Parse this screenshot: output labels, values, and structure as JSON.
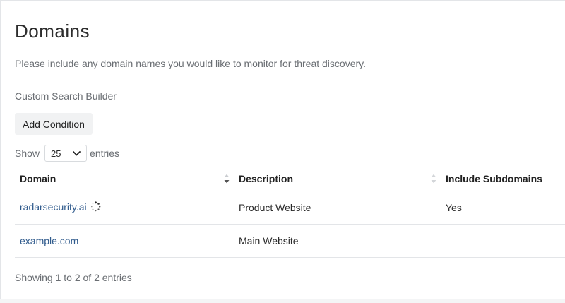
{
  "page": {
    "title": "Domains",
    "intro": "Please include any domain names you would like to monitor for threat discovery.",
    "builder_label": "Custom Search Builder",
    "add_condition_label": "Add Condition"
  },
  "length": {
    "prefix": "Show",
    "value": "25",
    "suffix": "entries"
  },
  "table": {
    "columns": [
      "Domain",
      "Description",
      "Include Subdomains"
    ],
    "rows": [
      {
        "domain": "radarsecurity.ai",
        "description": "Product Website",
        "include_subdomains": "Yes",
        "loading": true
      },
      {
        "domain": "example.com",
        "description": "Main Website",
        "include_subdomains": "",
        "loading": false
      }
    ]
  },
  "info": "Showing 1 to 2 of 2 entries",
  "icons": {
    "sort_active": "sort-desc-icon",
    "sort_inactive": "sort-both-icon",
    "select_arrow": "chevron-down-icon",
    "loading": "spinner-icon"
  },
  "colors": {
    "link": "#2f5a8c",
    "muted_text": "#6a6e73",
    "button_bg": "#f1f2f3"
  }
}
